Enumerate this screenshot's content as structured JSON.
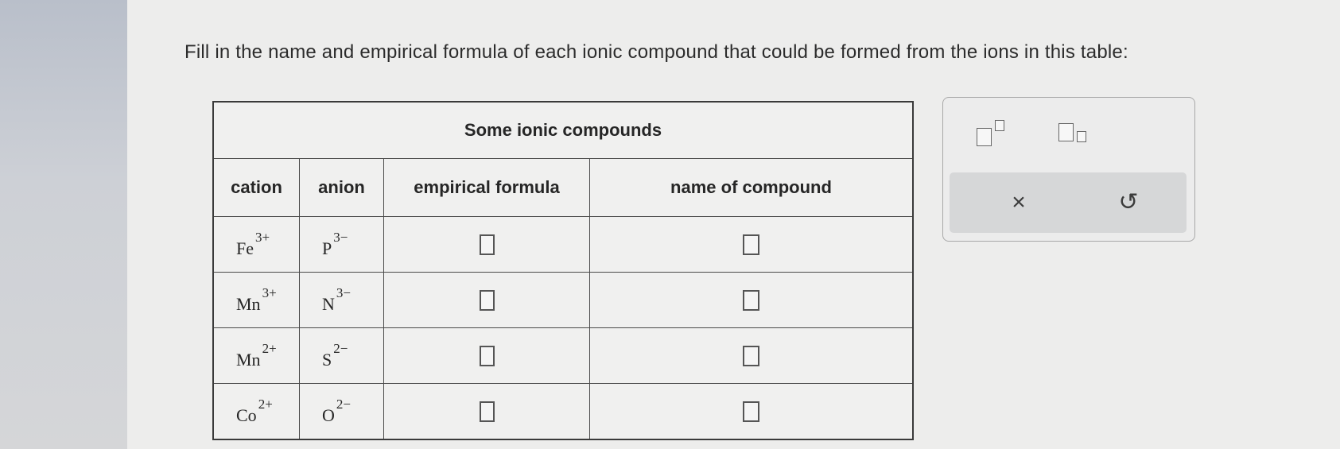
{
  "instruction": "Fill in the name and empirical formula of each ionic compound that could be formed from the ions in this table:",
  "table": {
    "caption": "Some ionic compounds",
    "headers": {
      "cation": "cation",
      "anion": "anion",
      "formula": "empirical formula",
      "name": "name of compound"
    },
    "rows": [
      {
        "cation": "Fe",
        "cation_charge": "3+",
        "anion": "P",
        "anion_charge": "3−"
      },
      {
        "cation": "Mn",
        "cation_charge": "3+",
        "anion": "N",
        "anion_charge": "3−"
      },
      {
        "cation": "Mn",
        "cation_charge": "2+",
        "anion": "S",
        "anion_charge": "2−"
      },
      {
        "cation": "Co",
        "cation_charge": "2+",
        "anion": "O",
        "anion_charge": "2−"
      }
    ]
  },
  "toolbox": {
    "buttons": [
      "superscript-template",
      "subscript-template"
    ],
    "actions": {
      "clear": "×",
      "undo": "↺"
    }
  }
}
